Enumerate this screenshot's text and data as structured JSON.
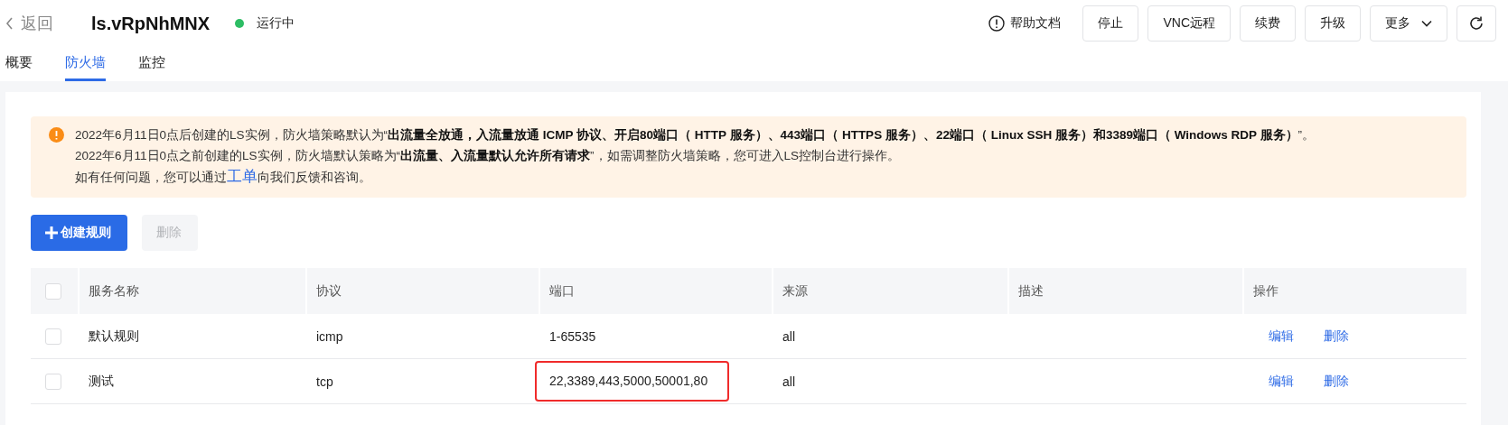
{
  "header": {
    "back": "返回",
    "title": "ls.vRpNhMNX",
    "status": {
      "label": "运行中",
      "color": "#2dbd64"
    },
    "help": "帮助文档",
    "buttons": [
      {
        "kind": "text",
        "label": "停止"
      },
      {
        "kind": "text",
        "label": "VNC远程"
      },
      {
        "kind": "text",
        "label": "续费"
      },
      {
        "kind": "text",
        "label": "升级"
      },
      {
        "kind": "menu",
        "label": "更多"
      },
      {
        "kind": "refresh"
      }
    ]
  },
  "tabs": [
    {
      "label": "概要",
      "selected": false
    },
    {
      "label": "防火墙",
      "selected": true
    },
    {
      "label": "监控",
      "selected": false
    }
  ],
  "notice": {
    "lines": [
      "2022年6月11日0点后创建的LS实例，防火墙策略默认为“**出流量全放通，入流量放通 ICMP 协议、开启80端口（ HTTP 服务）、443端口（ HTTPS 服务）、22端口（ Linux SSH 服务）和3389端口（ Windows RDP 服务）**”。",
      "2022年6月11日0点之前创建的LS实例，防火墙默认策略为“**出流量、入流量默认允许所有请求**”，如需调整防火墙策略，您可进入LS控制台进行操作。"
    ],
    "contact": {
      "before": "如有任何问题，您可以通过",
      "link": "工单",
      "after": "向我们反馈和咨询。"
    }
  },
  "actions": [
    {
      "label": "创建规则",
      "disabled": false
    },
    {
      "label": "删除",
      "disabled": true
    }
  ],
  "table": {
    "select_all_checked": false,
    "columns": [
      "服务名称",
      "协议",
      "端口",
      "来源",
      "描述",
      "操作"
    ],
    "rows": [
      {
        "checked": false,
        "name": "默认规则",
        "protocol": "icmp",
        "port": "1-65535",
        "port_highlighted": false,
        "source": "all",
        "ops": [
          "编辑",
          "删除"
        ]
      },
      {
        "checked": false,
        "name": "测试",
        "protocol": "tcp",
        "port": "22,3389,443,5000,50001,80",
        "port_highlighted": true,
        "source": "all",
        "ops": [
          "编辑",
          "删除"
        ]
      }
    ]
  }
}
